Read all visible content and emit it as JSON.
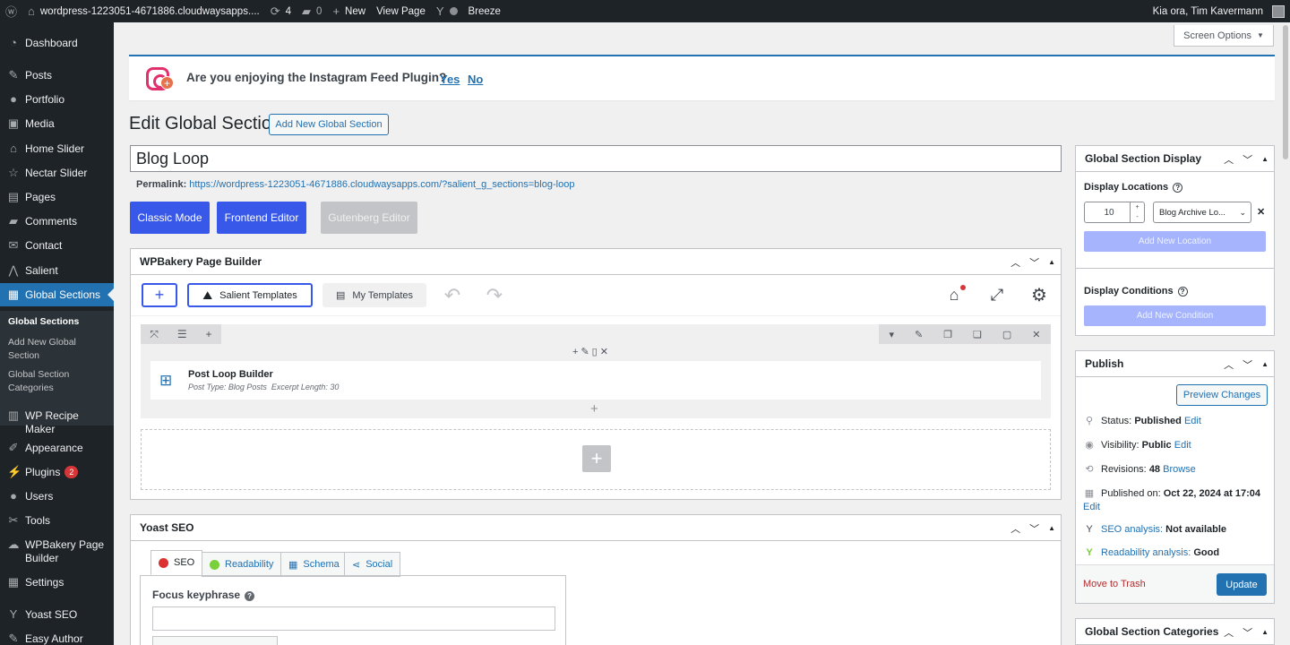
{
  "adminbar": {
    "site": "wordpress-1223051-4671886.cloudwaysapps....",
    "updates": "4",
    "comments": "0",
    "new": "New",
    "view_page": "View Page",
    "breeze": "Breeze",
    "greeting": "Kia ora, Tim Kavermann"
  },
  "menu": {
    "items": {
      "dashboard": "Dashboard",
      "posts": "Posts",
      "portfolio": "Portfolio",
      "media": "Media",
      "home_slider": "Home Slider",
      "nectar_slider": "Nectar Slider",
      "pages": "Pages",
      "comments": "Comments",
      "contact": "Contact",
      "salient": "Salient",
      "global_sections": "Global Sections",
      "wp_recipe": "WP Recipe Maker",
      "appearance": "Appearance",
      "plugins": "Plugins",
      "plugins_badge": "2",
      "users": "Users",
      "tools": "Tools",
      "wpbakery": "WPBakery Page Builder",
      "settings": "Settings",
      "yoast": "Yoast SEO",
      "easy_author": "Easy Author"
    },
    "submenu": {
      "global_sections": "Global Sections",
      "add_new": "Add New Global Section",
      "categories": "Global Section Categories"
    }
  },
  "screen_options": "Screen Options",
  "notice": {
    "question": "Are you enjoying the Instagram Feed Plugin?",
    "yes": "Yes",
    "no": "No"
  },
  "page": {
    "title": "Edit Global Section",
    "add_new": "Add New Global Section",
    "post_title": "Blog Loop",
    "permalink_label": "Permalink:",
    "permalink_url": "https://wordpress-1223051-4671886.cloudwaysapps.com/?salient_g_sections=blog-loop",
    "classic_mode": "Classic Mode",
    "frontend_editor": "Frontend Editor",
    "gutenberg_editor": "Gutenberg Editor"
  },
  "wpbakery": {
    "title": "WPBakery Page Builder",
    "salient_templates": "Salient Templates",
    "my_templates": "My Templates",
    "element_title": "Post Loop Builder",
    "element_meta": "Post Type: Blog Posts  Excerpt Length: 30"
  },
  "yoast": {
    "title": "Yoast SEO",
    "tabs": {
      "seo": "SEO",
      "readability": "Readability",
      "schema": "Schema",
      "social": "Social"
    },
    "focus_keyphrase": "Focus keyphrase"
  },
  "sidebar": {
    "display": {
      "title": "Global Section Display",
      "locations_label": "Display Locations",
      "priority": "10",
      "location_select": "Blog Archive Lo...",
      "add_location": "Add New Location",
      "conditions_label": "Display Conditions",
      "add_condition": "Add New Condition"
    },
    "publish": {
      "title": "Publish",
      "preview": "Preview Changes",
      "status_label": "Status:",
      "status_value": "Published",
      "visibility_label": "Visibility:",
      "visibility_value": "Public",
      "revisions_label": "Revisions:",
      "revisions_value": "48",
      "browse": "Browse",
      "published_label": "Published on:",
      "published_value": "Oct 22, 2024 at 17:04",
      "edit": "Edit",
      "seo_label": "SEO analysis:",
      "seo_value": "Not available",
      "readability_label": "Readability analysis:",
      "readability_value": "Good",
      "trash": "Move to Trash",
      "update": "Update"
    },
    "categories": {
      "title": "Global Section Categories"
    }
  },
  "colors": {
    "accent": "#2271b1",
    "wpb_blue": "#3858e9",
    "menu_bg": "#1d2327",
    "instagram": "#e1306c"
  }
}
